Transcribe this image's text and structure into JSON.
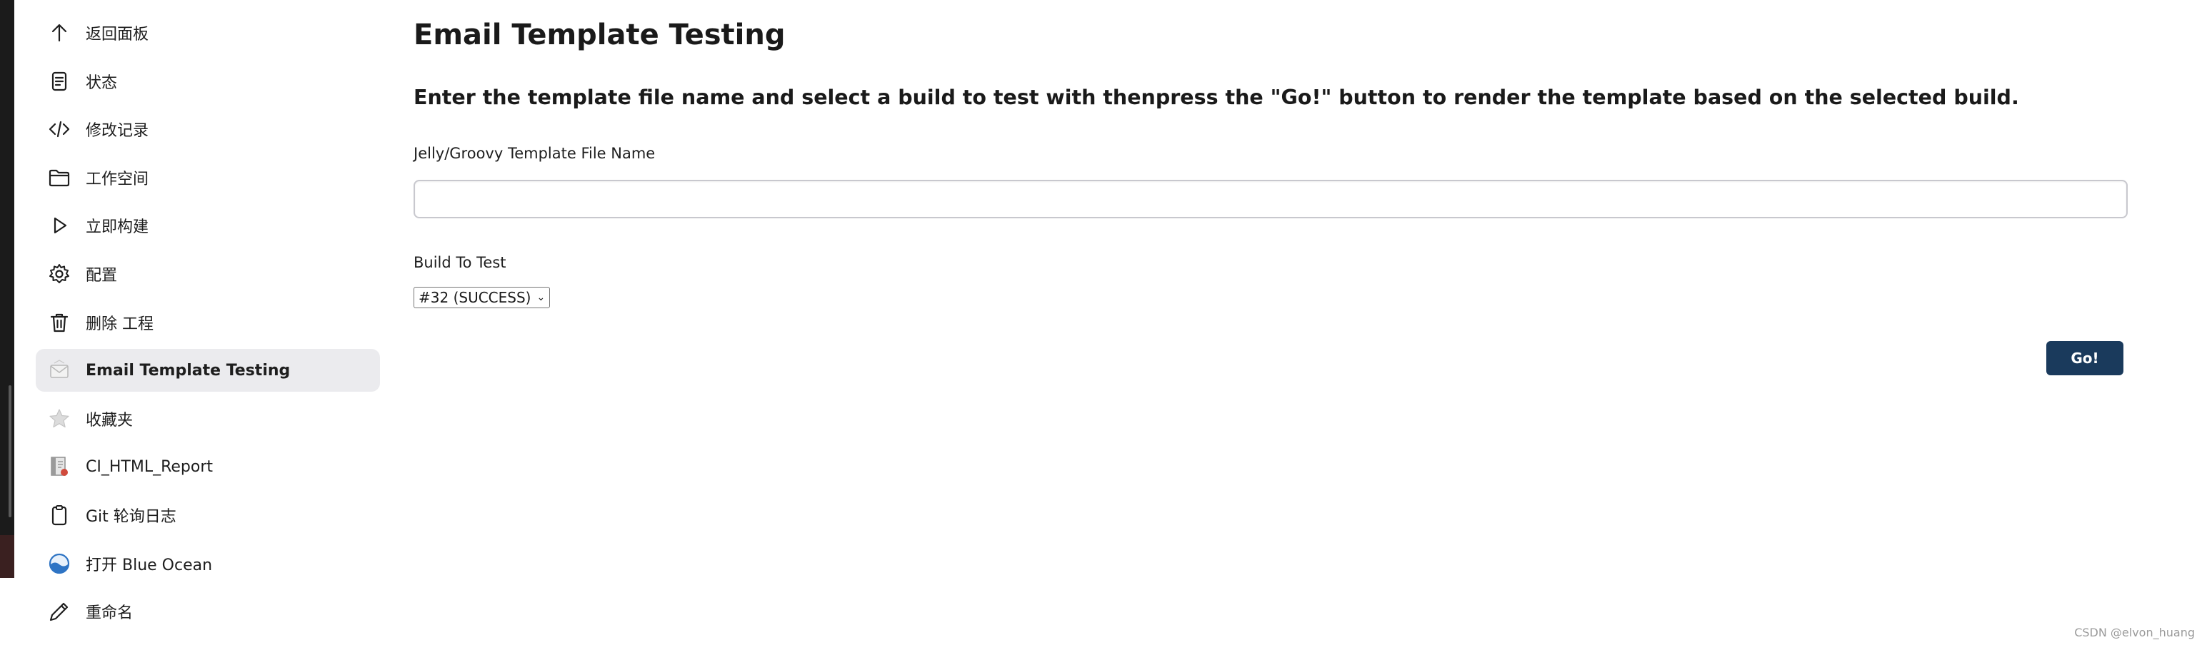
{
  "sidebar": {
    "items": [
      {
        "label": "返回面板",
        "icon": "arrow-up-icon"
      },
      {
        "label": "状态",
        "icon": "document-icon"
      },
      {
        "label": "修改记录",
        "icon": "code-icon"
      },
      {
        "label": "工作空间",
        "icon": "folder-icon"
      },
      {
        "label": "立即构建",
        "icon": "play-icon"
      },
      {
        "label": "配置",
        "icon": "gear-icon"
      },
      {
        "label": "删除 工程",
        "icon": "trash-icon"
      },
      {
        "label": "Email Template Testing",
        "icon": "email-icon",
        "active": true
      },
      {
        "label": "收藏夹",
        "icon": "star-icon"
      },
      {
        "label": "CI_HTML_Report",
        "icon": "report-icon"
      },
      {
        "label": "Git 轮询日志",
        "icon": "clipboard-icon"
      },
      {
        "label": "打开 Blue Ocean",
        "icon": "blue-ocean-icon"
      },
      {
        "label": "重命名",
        "icon": "pencil-icon"
      }
    ]
  },
  "main": {
    "title": "Email Template Testing",
    "description": "Enter the template file name and select a build to test with thenpress the \"Go!\" button to render the template based on the selected build.",
    "template_field": {
      "label": "Jelly/Groovy Template File Name",
      "value": "",
      "placeholder": ""
    },
    "build_field": {
      "label": "Build To Test",
      "selected": "#32 (SUCCESS)"
    },
    "go_label": "Go!"
  },
  "watermark": "CSDN @elvon_huang",
  "colors": {
    "accent": "#1a3a5c",
    "active_item_bg": "#ebebee"
  }
}
